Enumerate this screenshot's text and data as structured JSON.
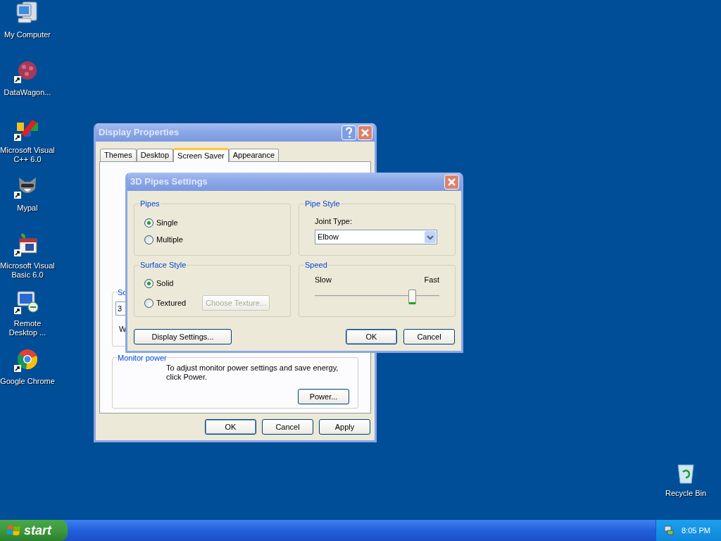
{
  "desktop_icons": [
    {
      "label": "My Computer",
      "shortcut": false
    },
    {
      "label": "DataWagon...",
      "shortcut": true
    },
    {
      "label": "Microsoft Visual C++ 6.0",
      "shortcut": true
    },
    {
      "label": "Mypal",
      "shortcut": true
    },
    {
      "label": "Microsoft Visual Basic 6.0",
      "shortcut": true
    },
    {
      "label": "Remote Desktop ...",
      "shortcut": true
    },
    {
      "label": "Google Chrome",
      "shortcut": true
    }
  ],
  "recycle_bin": {
    "label": "Recycle Bin"
  },
  "display_properties": {
    "title": "Display Properties",
    "tabs": [
      {
        "label": "Themes",
        "selected": false
      },
      {
        "label": "Desktop",
        "selected": false
      },
      {
        "label": "Screen Saver",
        "selected": true
      },
      {
        "label": "Appearance",
        "selected": false
      }
    ],
    "screen_saver_group": {
      "label": "Sc",
      "value": "3",
      "wait_label": "W"
    },
    "monitor_power": {
      "label": "Monitor power",
      "text": "To adjust monitor power settings and save energy, click Power.",
      "button": "Power..."
    },
    "buttons": [
      {
        "label": "OK",
        "default": true
      },
      {
        "label": "Cancel",
        "default": false
      },
      {
        "label": "Apply",
        "default": false
      }
    ]
  },
  "pipes_dialog": {
    "title": "3D Pipes Settings",
    "pipes": {
      "label": "Pipes",
      "options": [
        {
          "label": "Single",
          "selected": true
        },
        {
          "label": "Multiple",
          "selected": false
        }
      ]
    },
    "pipe_style": {
      "label": "Pipe Style",
      "joint_label": "Joint Type:",
      "joint_value": "Elbow"
    },
    "surface_style": {
      "label": "Surface Style",
      "options": [
        {
          "label": "Solid",
          "selected": true
        },
        {
          "label": "Textured",
          "selected": false
        }
      ],
      "texture_button": {
        "label": "Choose Texture...",
        "disabled": true
      }
    },
    "speed": {
      "label": "Speed",
      "min_label": "Slow",
      "max_label": "Fast",
      "level": 0.78
    },
    "display_settings_button": "Display Settings...",
    "buttons": [
      {
        "label": "OK",
        "default": true
      },
      {
        "label": "Cancel",
        "default": false
      }
    ]
  },
  "taskbar": {
    "start": "start",
    "clock": "8:05 PM"
  }
}
